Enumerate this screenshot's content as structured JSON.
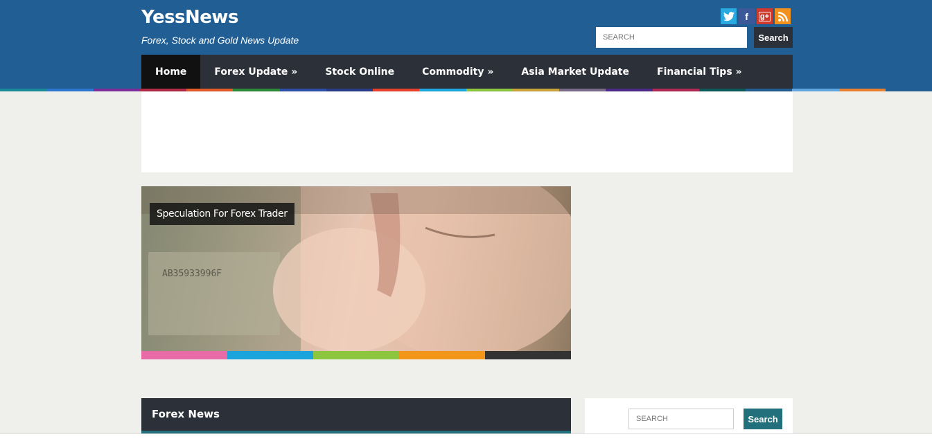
{
  "site": {
    "title": "YessNews",
    "tagline": "Forex, Stock and Gold News Update"
  },
  "social": [
    {
      "name": "twitter",
      "glyph": "🐦",
      "color": "#2aa9e0"
    },
    {
      "name": "facebook",
      "glyph": "f",
      "color": "#3b5998"
    },
    {
      "name": "google-plus",
      "glyph": "g+",
      "color": "#d0382b"
    },
    {
      "name": "rss",
      "glyph": "⟟",
      "color": "#f3911f"
    }
  ],
  "top_search": {
    "placeholder": "SEARCH",
    "button": "Search"
  },
  "nav": {
    "items": [
      {
        "label": "Home",
        "active": true
      },
      {
        "label": "Forex Update »",
        "active": false
      },
      {
        "label": "Stock Online",
        "active": false
      },
      {
        "label": "Commodity »",
        "active": false
      },
      {
        "label": "Asia Market Update",
        "active": false
      },
      {
        "label": "Financial Tips »",
        "active": false
      }
    ]
  },
  "color_strip": [
    "#1a8a9b",
    "#2b77d0",
    "#7d2c9a",
    "#b02a45",
    "#e05b25",
    "#2a8a3a",
    "#2b4fa8",
    "#2a3b8a",
    "#e8402a",
    "#1ba8e0",
    "#8cc63f",
    "#c9a23a",
    "#7a6b8a",
    "#4b2a8a",
    "#b02a55",
    "#0a5a5a",
    "#215e93",
    "#5fa6e0",
    "#e88030",
    "#215e93"
  ],
  "featured": {
    "caption": "Speculation For Forex Trader",
    "bar_colors": [
      "#e86aa6",
      "#1ba4dc",
      "#8cc63f",
      "#f39518",
      "#333333"
    ]
  },
  "forex_news": {
    "title": "Forex News"
  },
  "side_search": {
    "placeholder": "SEARCH",
    "button": "Search"
  }
}
